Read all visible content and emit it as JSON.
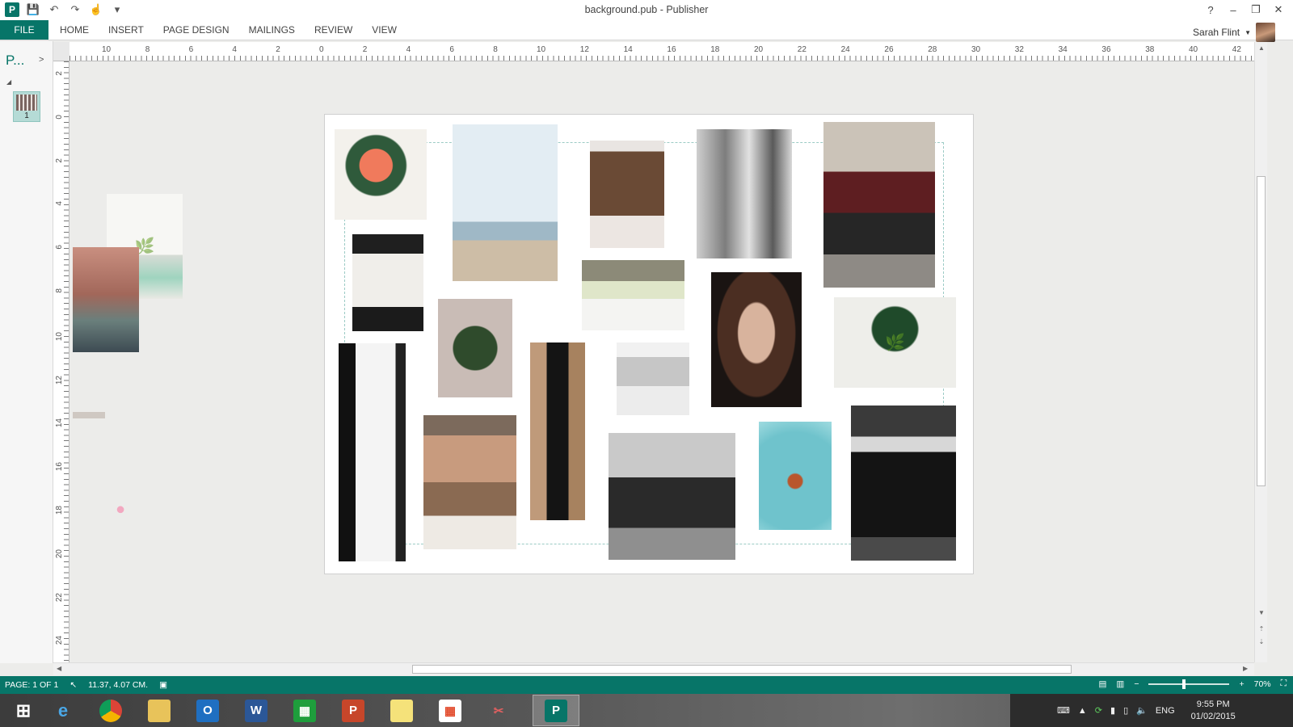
{
  "window": {
    "title": "background.pub - Publisher",
    "controls": [
      "?",
      "–",
      "❐",
      "✕"
    ]
  },
  "ribbon": {
    "file_label": "FILE",
    "tabs": [
      "HOME",
      "INSERT",
      "PAGE DESIGN",
      "MAILINGS",
      "REVIEW",
      "VIEW"
    ],
    "user_name": "Sarah Flint"
  },
  "nav_pane": {
    "label": "P...",
    "page_number": "1"
  },
  "rulers": {
    "top": [
      "10",
      "8",
      "6",
      "4",
      "2",
      "0",
      "2",
      "4",
      "6",
      "8",
      "10",
      "12",
      "14",
      "16",
      "18",
      "20",
      "22",
      "24",
      "26",
      "28",
      "30",
      "32",
      "34",
      "36",
      "38",
      "40",
      "42"
    ],
    "left": [
      "2",
      "0",
      "2",
      "4",
      "6",
      "8",
      "10",
      "12",
      "14",
      "16",
      "18",
      "20",
      "22",
      "24"
    ]
  },
  "status": {
    "page": "PAGE: 1 OF 1",
    "position": "11.37, 4.07 CM.",
    "zoom": "70%"
  },
  "tray": {
    "language": "ENG",
    "time": "9:55 PM",
    "date": "01/02/2015"
  },
  "colors": {
    "accent": "#077568"
  }
}
